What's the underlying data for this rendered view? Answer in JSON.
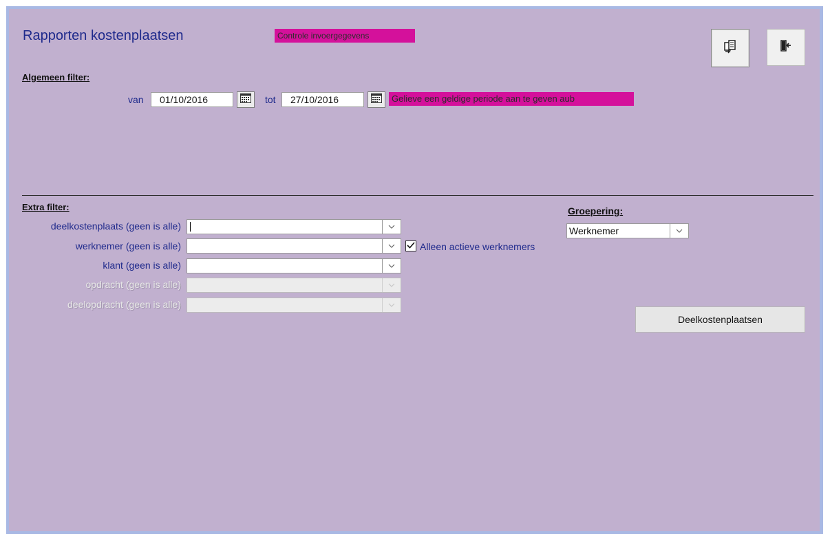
{
  "header": {
    "title": "Rapporten kostenplaatsen",
    "alert": "Controle invoergegevens"
  },
  "toolbar": {
    "buttons": [
      {
        "icon": "report-refresh-icon"
      },
      {
        "icon": "exit-door-icon"
      }
    ]
  },
  "general_filter": {
    "label": "Algemeen filter:",
    "from_label": "van",
    "from_value": "01/10/2016",
    "to_label": "tot",
    "to_value": "27/10/2016",
    "validation_message": "Gelieve een geldige periode aan te geven aub"
  },
  "extra_filter": {
    "label": "Extra filter:",
    "fields": [
      {
        "label": "deelkostenplaats (geen is alle)",
        "value": "",
        "enabled": true
      },
      {
        "label": "werknemer (geen is alle)",
        "value": "",
        "enabled": true
      },
      {
        "label": "klant (geen is alle)",
        "value": "",
        "enabled": true
      },
      {
        "label": "opdracht (geen is alle)",
        "value": "",
        "enabled": false
      },
      {
        "label": "deelopdracht (geen is alle)",
        "value": "",
        "enabled": false
      }
    ],
    "active_only_label": "Alleen actieve werknemers",
    "active_only_checked": true
  },
  "grouping": {
    "label": "Groepering:",
    "value": "Werknemer"
  },
  "actions": {
    "sub_cost_centers_label": "Deelkostenplaatsen"
  },
  "colors": {
    "background": "#c1b0cf",
    "title": "#1f2a8c",
    "alert": "#d4119b",
    "frame": "#a9b9e4"
  }
}
